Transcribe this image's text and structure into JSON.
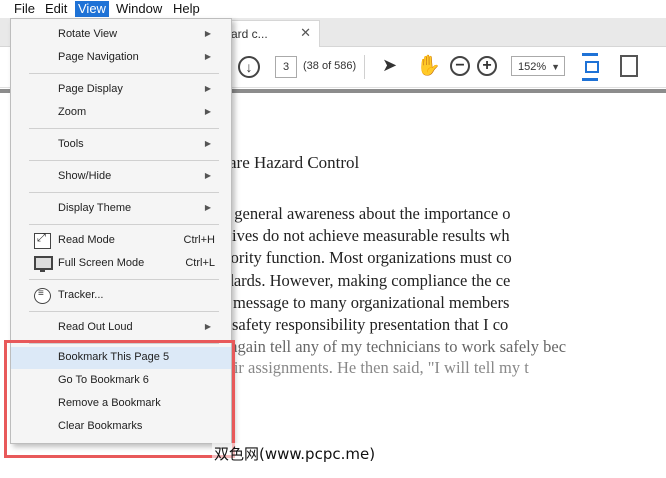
{
  "menubar": [
    "File",
    "Edit",
    "View",
    "Window",
    "Help"
  ],
  "tab": {
    "title": "ard c...",
    "close": "✕"
  },
  "toolbar": {
    "page_input": "3",
    "page_count": "(38 of 586)",
    "zoom": "152%"
  },
  "document": {
    "heading": "are Hazard Control",
    "lines": [
      "nmunicate a general awareness about the importance o",
      "ended initiatives do not achieve measurable results wh",
      "control a priority function. Most organizations must co",
      "mental standards. However, making compliance the ce",
      "d the wrong message to many organizational members",
      "or leaving a safety responsibility presentation that I co",
      "I will never again tell any of my technicians to work safely bec",
      "or one of their assignments. He then said, \"I will tell my t"
    ]
  },
  "menu": {
    "items": [
      {
        "label": "Rotate View",
        "submenu": true
      },
      {
        "label": "Page Navigation",
        "submenu": true
      },
      {
        "label": "Page Display",
        "submenu": true
      },
      {
        "label": "Zoom",
        "submenu": true
      },
      {
        "label": "Tools",
        "submenu": true
      },
      {
        "label": "Show/Hide",
        "submenu": true
      },
      {
        "label": "Display Theme",
        "submenu": true
      },
      {
        "label": "Read Mode",
        "shortcut": "Ctrl+H",
        "icon": "read-mode-icon"
      },
      {
        "label": "Full Screen Mode",
        "shortcut": "Ctrl+L",
        "icon": "full-screen-icon"
      },
      {
        "label": "Tracker...",
        "icon": "tracker-icon"
      },
      {
        "label": "Read Out Loud",
        "submenu": true
      },
      {
        "label": "Bookmark This Page 5",
        "highlighted": true
      },
      {
        "label": "Go To Bookmark 6"
      },
      {
        "label": "Remove a Bookmark"
      },
      {
        "label": "Clear Bookmarks"
      }
    ]
  },
  "watermark": "双色网(www.pcpc.me)",
  "colors": {
    "menu_highlight": "#1e72d6",
    "annotation_border": "#e8595a",
    "hover_row": "#dce9f7"
  }
}
